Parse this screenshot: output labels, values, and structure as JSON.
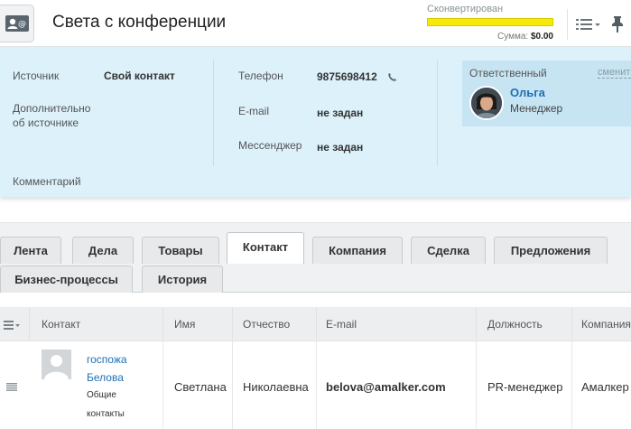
{
  "header": {
    "title": "Света с конференции",
    "conversion_label": "Сконвертирован",
    "sum_label": "Сумма:",
    "sum_value": "$0.00",
    "accent": "#f7ea0b"
  },
  "info": {
    "source_label": "Источник",
    "source_value": "Свой контакт",
    "extra_source_label_1": "Дополнительно",
    "extra_source_label_2": "об источнике",
    "comment_label": "Комментарий",
    "phone_label": "Телефон",
    "phone_value": "9875698412",
    "email_label": "E-mail",
    "email_value": "не задан",
    "messenger_label": "Мессенджер",
    "messenger_value": "не задан",
    "responsible_label": "Ответственный",
    "responsible_change": "сменить",
    "responsible_name": "Ольга",
    "responsible_position": "Менеджер",
    "panel_color": "#dcf1fa"
  },
  "tabs": [
    {
      "label": "Лента"
    },
    {
      "label": "Дела"
    },
    {
      "label": "Товары"
    },
    {
      "label": "Контакт",
      "active": true
    },
    {
      "label": "Компания"
    },
    {
      "label": "Сделка"
    },
    {
      "label": "Предложения"
    },
    {
      "label": "Бизнес-процессы"
    },
    {
      "label": "История"
    }
  ],
  "table": {
    "columns": [
      "Контакт",
      "Имя",
      "Отчество",
      "E-mail",
      "Должность",
      "Компания"
    ],
    "row": {
      "contact_line1": "госпожа",
      "contact_line2": "Белова",
      "type_line1": "Общие",
      "type_line2": "контакты",
      "first_name": "Светлана",
      "middle_name": "Николаевна",
      "email": "belova@amalker.com",
      "position": "PR-менеджер",
      "company": "Амалкер"
    }
  },
  "icons": {
    "entity": "contact-card-icon",
    "list": "list-menu-icon",
    "pin": "pin-icon",
    "phone": "phone-icon",
    "drag": "drag-handle-icon"
  }
}
